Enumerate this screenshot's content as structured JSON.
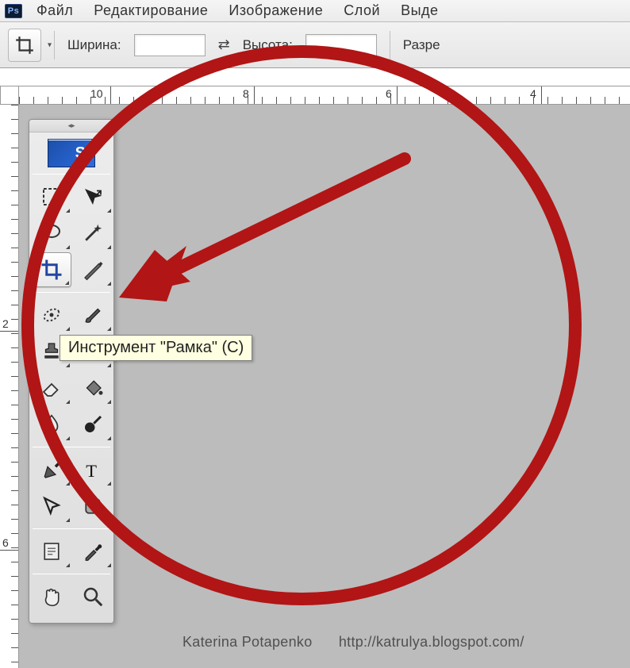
{
  "menubar": {
    "items": [
      "Файл",
      "Редактирование",
      "Изображение",
      "Слой",
      "Выде"
    ]
  },
  "optionsbar": {
    "width_label": "Ширина:",
    "height_label": "Высота:",
    "res_label": "Разре",
    "width_value": "",
    "height_value": ""
  },
  "ruler": {
    "h_labels": [
      "10",
      "8",
      "6",
      "4"
    ],
    "v_labels": [
      "2",
      "6"
    ]
  },
  "toolbox": {
    "logo_text": "S",
    "tools": [
      {
        "name": "marquee-icon"
      },
      {
        "name": "move-icon"
      },
      {
        "name": "lasso-icon"
      },
      {
        "name": "magic-wand-icon"
      },
      {
        "name": "crop-icon",
        "selected": true
      },
      {
        "name": "slice-icon"
      },
      {
        "name": "healing-icon"
      },
      {
        "name": "brush-icon"
      },
      {
        "name": "stamp-icon"
      },
      {
        "name": "history-brush-icon"
      },
      {
        "name": "eraser-icon"
      },
      {
        "name": "bucket-icon"
      },
      {
        "name": "blur-icon"
      },
      {
        "name": "dodge-icon"
      },
      {
        "name": "pen-icon"
      },
      {
        "name": "type-icon"
      },
      {
        "name": "path-select-icon"
      },
      {
        "name": "shape-icon"
      },
      {
        "name": "notes-icon"
      },
      {
        "name": "eyedropper-icon"
      },
      {
        "name": "hand-icon"
      },
      {
        "name": "zoom-icon"
      }
    ]
  },
  "tooltip": {
    "text": "Инструмент \"Рамка\" (C)"
  },
  "watermark": {
    "author": "Katerina Potapenko",
    "url": "http://katrulya.blogspot.com/"
  },
  "annotation": {
    "color": "#b11515"
  }
}
